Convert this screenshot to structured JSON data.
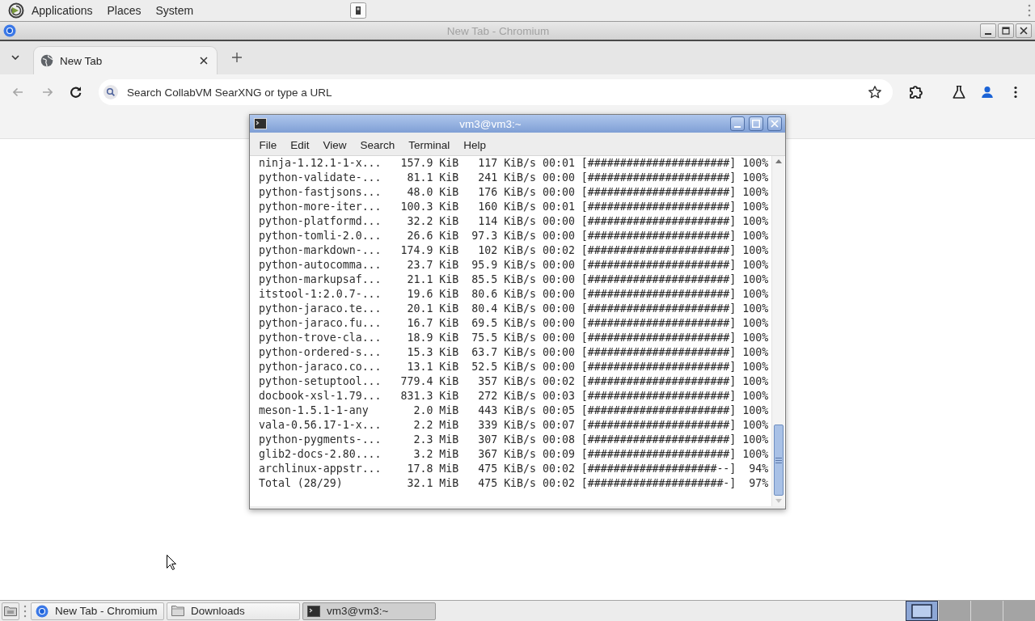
{
  "top_panel": {
    "menus": [
      "Applications",
      "Places",
      "System"
    ]
  },
  "browser": {
    "title": "New Tab - Chromium",
    "active": false,
    "tabs": [
      {
        "label": "New Tab",
        "selected": true
      }
    ],
    "nav_buttons": [
      {
        "kind": "back",
        "disabled": true
      },
      {
        "kind": "forward",
        "disabled": true
      },
      {
        "kind": "reload",
        "disabled": false
      }
    ],
    "omnibox": {
      "placeholder": "Search CollabVM SearXNG or type a URL"
    }
  },
  "terminal": {
    "title": "vm3@vm3:~",
    "active": true,
    "menu": [
      "File",
      "Edit",
      "View",
      "Search",
      "Terminal",
      "Help"
    ],
    "lines": [
      "ninja-1.12.1-1-x...   157.9 KiB   117 KiB/s 00:01 [######################] 100%",
      "python-validate-...    81.1 KiB   241 KiB/s 00:00 [######################] 100%",
      "python-fastjsons...    48.0 KiB   176 KiB/s 00:00 [######################] 100%",
      "python-more-iter...   100.3 KiB   160 KiB/s 00:01 [######################] 100%",
      "python-platformd...    32.2 KiB   114 KiB/s 00:00 [######################] 100%",
      "python-tomli-2.0...    26.6 KiB  97.3 KiB/s 00:00 [######################] 100%",
      "python-markdown-...   174.9 KiB   102 KiB/s 00:02 [######################] 100%",
      "python-autocomma...    23.7 KiB  95.9 KiB/s 00:00 [######################] 100%",
      "python-markupsaf...    21.1 KiB  85.5 KiB/s 00:00 [######################] 100%",
      "itstool-1:2.0.7-...    19.6 KiB  80.6 KiB/s 00:00 [######################] 100%",
      "python-jaraco.te...    20.1 KiB  80.4 KiB/s 00:00 [######################] 100%",
      "python-jaraco.fu...    16.7 KiB  69.5 KiB/s 00:00 [######################] 100%",
      "python-trove-cla...    18.9 KiB  75.5 KiB/s 00:00 [######################] 100%",
      "python-ordered-s...    15.3 KiB  63.7 KiB/s 00:00 [######################] 100%",
      "python-jaraco.co...    13.1 KiB  52.5 KiB/s 00:00 [######################] 100%",
      "python-setuptool...   779.4 KiB   357 KiB/s 00:02 [######################] 100%",
      "docbook-xsl-1.79...   831.3 KiB   272 KiB/s 00:03 [######################] 100%",
      "meson-1.5.1-1-any       2.0 MiB   443 KiB/s 00:05 [######################] 100%",
      "vala-0.56.17-1-x...     2.2 MiB   339 KiB/s 00:07 [######################] 100%",
      "python-pygments-...     2.3 MiB   307 KiB/s 00:08 [######################] 100%",
      "glib2-docs-2.80....     3.2 MiB   367 KiB/s 00:09 [######################] 100%",
      "archlinux-appstr...    17.8 MiB   475 KiB/s 00:02 [####################--]  94%",
      "Total (28/29)          32.1 MiB   475 KiB/s 00:02 [#####################-]  97%"
    ]
  },
  "taskbar": {
    "buttons": [
      {
        "label": "New Tab - Chromium",
        "kind": "browser",
        "selected": false
      },
      {
        "label": "Downloads",
        "kind": "folder",
        "selected": false
      },
      {
        "label": "vm3@vm3:~",
        "kind": "terminal",
        "selected": true
      }
    ],
    "workspaces": [
      {
        "selected": true,
        "has_window": true
      },
      {
        "selected": false,
        "has_window": false
      },
      {
        "selected": false,
        "has_window": false
      },
      {
        "selected": false,
        "has_window": false
      }
    ]
  }
}
